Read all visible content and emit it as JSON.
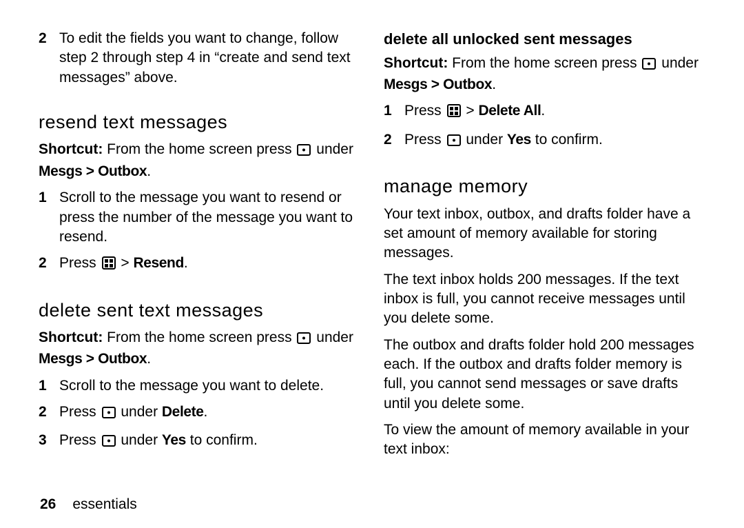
{
  "left": {
    "step2": {
      "num": "2",
      "text": "To edit the fields you want to change, follow step 2 through step 4 in “create and send text messages” above."
    },
    "resend": {
      "heading": "resend text messages",
      "shortcut_label": "Shortcut:",
      "shortcut_before": " From the home screen press ",
      "shortcut_after": " under ",
      "shortcut_path": "Mesgs > Outbox",
      "steps": [
        {
          "num": "1",
          "text": "Scroll to the message you want to resend or press the number of the message you want to resend."
        },
        {
          "num": "2",
          "before": "Press ",
          "after": "  > ",
          "action": "Resend",
          "end": "."
        }
      ]
    },
    "delete": {
      "heading": "delete sent text messages",
      "shortcut_label": "Shortcut:",
      "shortcut_before": " From the home screen press ",
      "shortcut_after": " under ",
      "shortcut_path": "Mesgs > Outbox",
      "steps": [
        {
          "num": "1",
          "text": "Scroll to the message you want to delete."
        },
        {
          "num": "2",
          "before": "Press ",
          "after": " under ",
          "action": "Delete",
          "end": "."
        },
        {
          "num": "3",
          "before": "Press ",
          "after": " under ",
          "action": "Yes",
          "end": " to confirm."
        }
      ]
    }
  },
  "right": {
    "deleteall": {
      "heading": "delete all unlocked sent messages",
      "shortcut_label": "Shortcut:",
      "shortcut_before": " From the home screen press ",
      "shortcut_after": " under ",
      "shortcut_path": "Mesgs > Outbox",
      "steps": [
        {
          "num": "1",
          "before": "Press ",
          "after": "  > ",
          "action": "Delete All",
          "end": "."
        },
        {
          "num": "2",
          "before": "Press ",
          "after": " under ",
          "action": "Yes",
          "end": " to confirm."
        }
      ]
    },
    "memory": {
      "heading": "manage memory",
      "p1": "Your text inbox, outbox, and drafts folder have a set amount of memory available for storing messages.",
      "p2": "The text inbox holds 200 messages. If the text inbox is full, you cannot receive messages until you delete some.",
      "p3": "The outbox and drafts folder hold 200 messages each. If the outbox and drafts folder memory is full, you cannot send messages or save drafts until you delete some.",
      "p4": "To view the amount of memory available in your text inbox:"
    }
  },
  "footer": {
    "page": "26",
    "section": "essentials"
  }
}
